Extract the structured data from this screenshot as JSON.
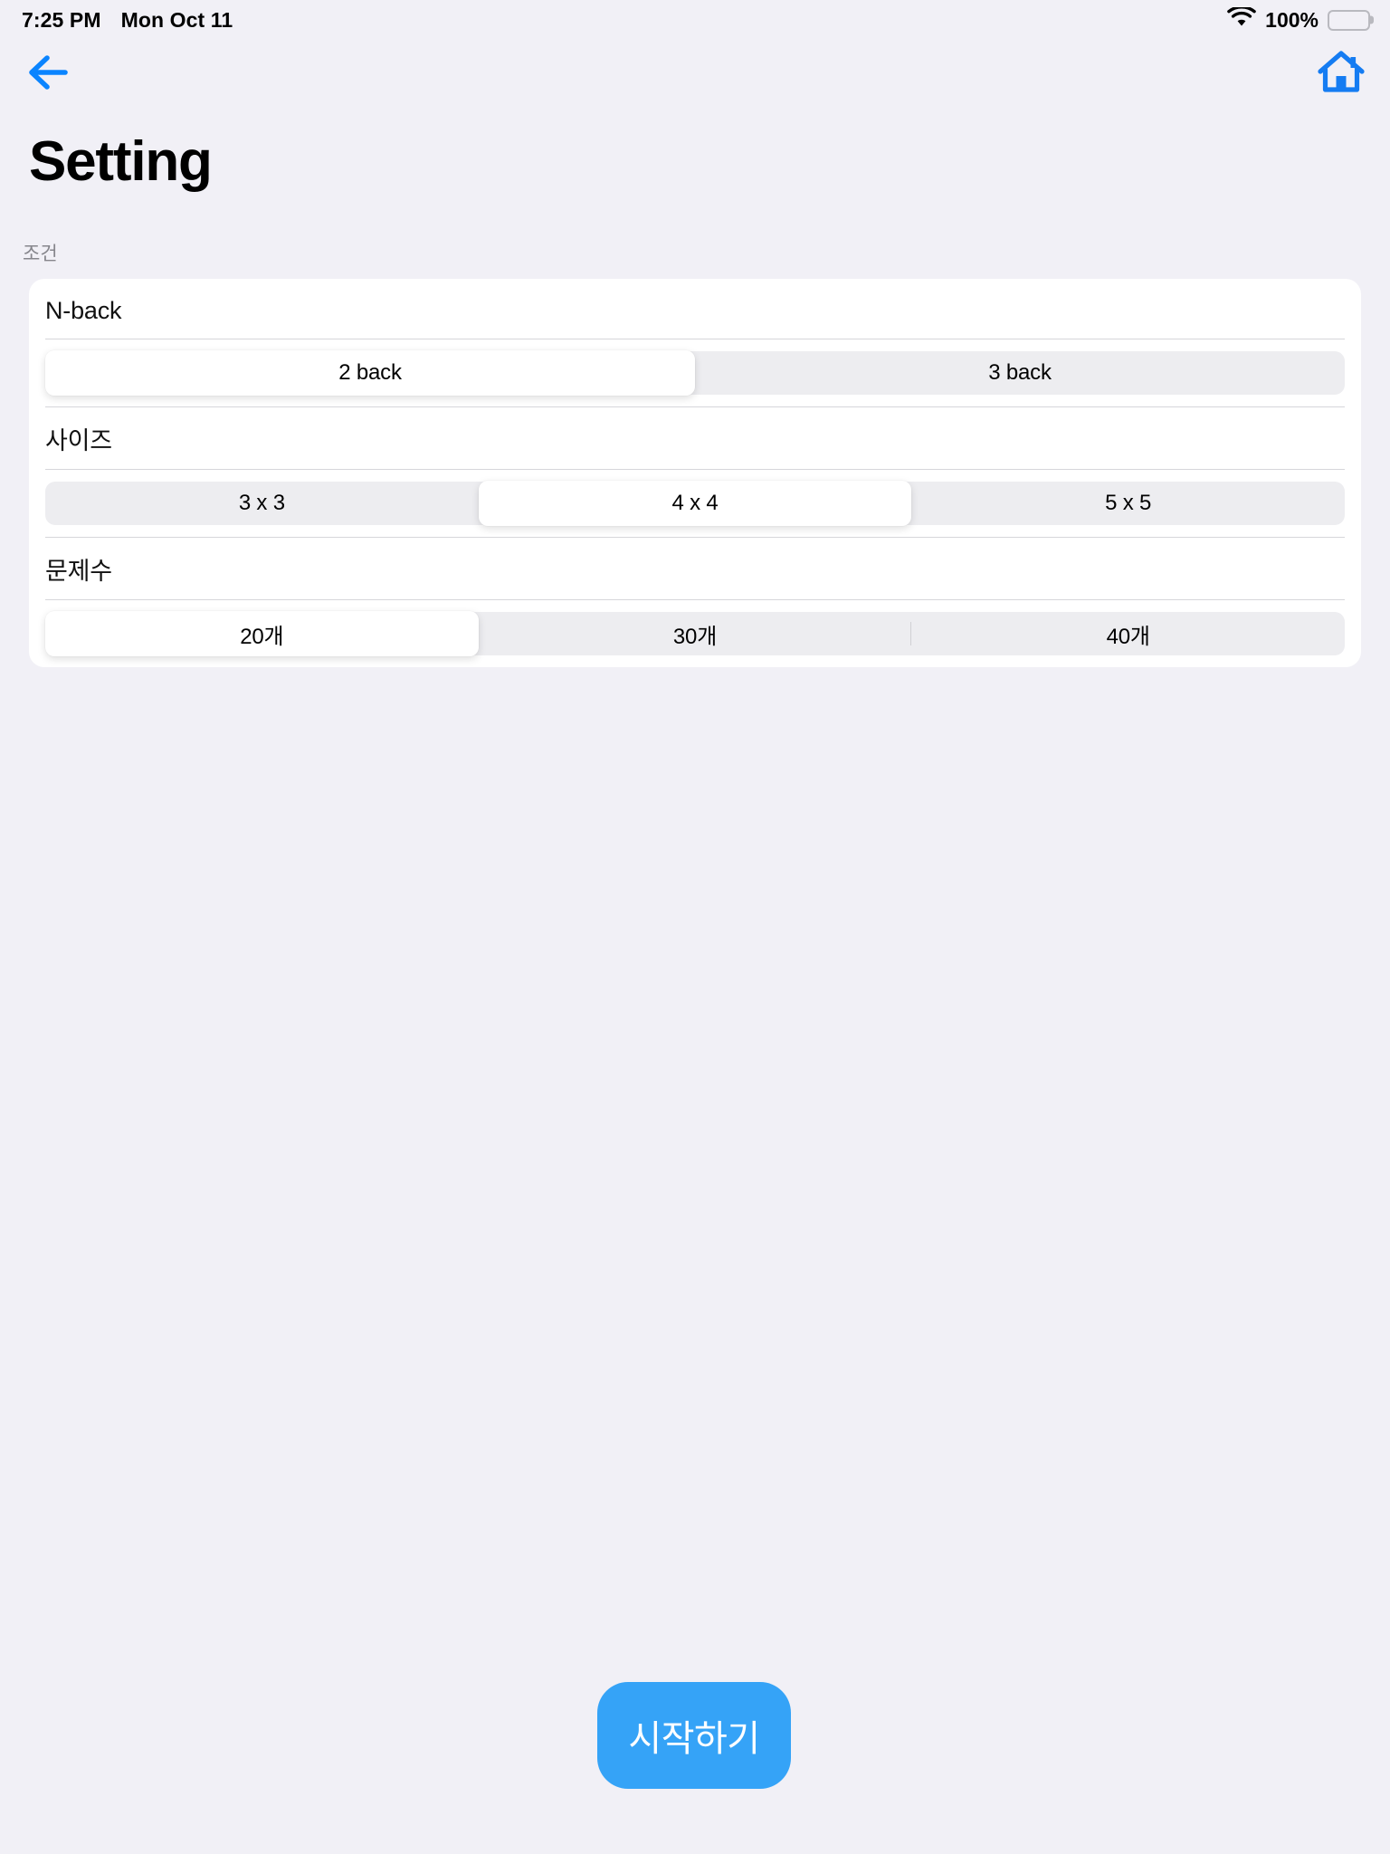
{
  "status_bar": {
    "time": "7:25 PM",
    "date": "Mon Oct 11",
    "wifi_icon": "wifi-icon",
    "battery_percent": "100%",
    "battery_icon": "battery-full-icon"
  },
  "nav": {
    "back_icon": "arrow-left-icon",
    "home_icon": "home-icon",
    "accent_color": "#0a84ff"
  },
  "header": {
    "title": "Setting",
    "section_label": "조건"
  },
  "settings": [
    {
      "label": "N-back",
      "options": [
        "2 back",
        "3 back"
      ],
      "selected_index": 0,
      "separators": []
    },
    {
      "label": "사이즈",
      "options": [
        "3 x 3",
        "4 x 4",
        "5 x 5"
      ],
      "selected_index": 1,
      "separators": []
    },
    {
      "label": "문제수",
      "options": [
        "20개",
        "30개",
        "40개"
      ],
      "selected_index": 0,
      "separators": [
        2
      ]
    }
  ],
  "footer": {
    "start_label": "시작하기",
    "start_color": "#35a3f7"
  },
  "colors": {
    "page_background": "#f1f0f6",
    "card_background": "#ffffff",
    "segment_track": "#ededf0",
    "divider": "#d6d6da",
    "muted_text": "#86868c"
  }
}
